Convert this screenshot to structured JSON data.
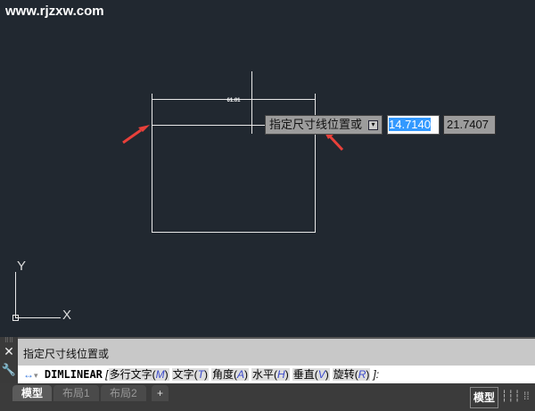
{
  "watermark": "www.rjzxw.com",
  "drawing": {
    "dimension_text": "61.01"
  },
  "tooltip": {
    "prompt": "指定尺寸线位置或",
    "x_value": "14.7140",
    "y_value": "21.7407"
  },
  "ucs": {
    "x": "X",
    "y": "Y"
  },
  "command": {
    "history": "指定尺寸线位置或",
    "name": "DIMLINEAR",
    "options": [
      {
        "label": "多行文字",
        "key": "M"
      },
      {
        "label": "文字",
        "key": "T"
      },
      {
        "label": "角度",
        "key": "A"
      },
      {
        "label": "水平",
        "key": "H"
      },
      {
        "label": "垂直",
        "key": "V"
      },
      {
        "label": "旋转",
        "key": "R"
      }
    ],
    "open": "[",
    "close": "]:"
  },
  "tabs": [
    "模型",
    "布局1",
    "布局2",
    "+"
  ],
  "status": {
    "model": "模型"
  },
  "colors": {
    "arrow": "#e8403a",
    "selection": "#3399ff"
  }
}
